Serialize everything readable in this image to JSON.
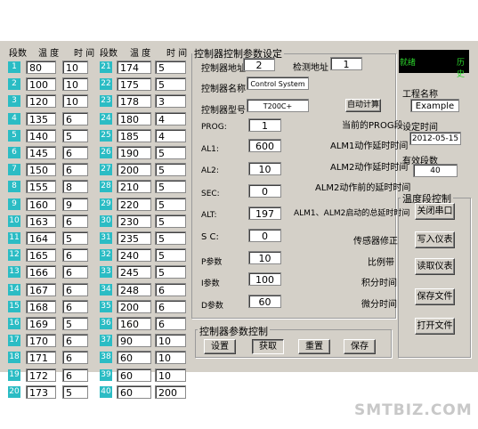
{
  "headers": {
    "left": {
      "seg": "段数",
      "temp": "温 度",
      "time": "时 间"
    },
    "right": {
      "seg": "段数",
      "temp": "温 度",
      "time": "时 间"
    }
  },
  "segments_left": [
    {
      "n": "1",
      "temp": "80",
      "time": "10"
    },
    {
      "n": "2",
      "temp": "100",
      "time": "10"
    },
    {
      "n": "3",
      "temp": "120",
      "time": "10"
    },
    {
      "n": "4",
      "temp": "135",
      "time": "6"
    },
    {
      "n": "5",
      "temp": "140",
      "time": "5"
    },
    {
      "n": "6",
      "temp": "145",
      "time": "6"
    },
    {
      "n": "7",
      "temp": "150",
      "time": "6"
    },
    {
      "n": "8",
      "temp": "155",
      "time": "8"
    },
    {
      "n": "9",
      "temp": "160",
      "time": "9"
    },
    {
      "n": "10",
      "temp": "163",
      "time": "6"
    },
    {
      "n": "11",
      "temp": "164",
      "time": "5"
    },
    {
      "n": "12",
      "temp": "165",
      "time": "6"
    },
    {
      "n": "13",
      "temp": "166",
      "time": "6"
    },
    {
      "n": "14",
      "temp": "167",
      "time": "6"
    },
    {
      "n": "15",
      "temp": "168",
      "time": "6"
    },
    {
      "n": "16",
      "temp": "169",
      "time": "5"
    },
    {
      "n": "17",
      "temp": "170",
      "time": "6"
    },
    {
      "n": "18",
      "temp": "171",
      "time": "6"
    },
    {
      "n": "19",
      "temp": "172",
      "time": "6"
    },
    {
      "n": "20",
      "temp": "173",
      "time": "5"
    }
  ],
  "segments_right": [
    {
      "n": "21",
      "temp": "174",
      "time": "5"
    },
    {
      "n": "22",
      "temp": "175",
      "time": "5"
    },
    {
      "n": "23",
      "temp": "178",
      "time": "3"
    },
    {
      "n": "24",
      "temp": "180",
      "time": "4"
    },
    {
      "n": "25",
      "temp": "185",
      "time": "4"
    },
    {
      "n": "26",
      "temp": "190",
      "time": "5"
    },
    {
      "n": "27",
      "temp": "200",
      "time": "5"
    },
    {
      "n": "28",
      "temp": "210",
      "time": "5"
    },
    {
      "n": "29",
      "temp": "220",
      "time": "5"
    },
    {
      "n": "30",
      "temp": "230",
      "time": "5"
    },
    {
      "n": "31",
      "temp": "235",
      "time": "5"
    },
    {
      "n": "32",
      "temp": "240",
      "time": "5"
    },
    {
      "n": "33",
      "temp": "245",
      "time": "5"
    },
    {
      "n": "34",
      "temp": "248",
      "time": "6"
    },
    {
      "n": "35",
      "temp": "200",
      "time": "6"
    },
    {
      "n": "36",
      "temp": "160",
      "time": "6"
    },
    {
      "n": "37",
      "temp": "90",
      "time": "10"
    },
    {
      "n": "38",
      "temp": "60",
      "time": "10"
    },
    {
      "n": "39",
      "temp": "60",
      "time": "10"
    },
    {
      "n": "40",
      "temp": "60",
      "time": "200"
    }
  ],
  "params": {
    "group_title": "控制器控制参数设定",
    "ctrl_addr_label": "控制器地址",
    "ctrl_addr": "2",
    "detect_addr_label": "检测地址",
    "detect_addr": "1",
    "ctrl_name_label": "控制器名称",
    "ctrl_name": "Control System",
    "ctrl_model_label": "控制器型号",
    "ctrl_model": "T200C+",
    "auto_calc": "自动计算",
    "prog_label": "PROG:",
    "prog": "1",
    "prog_desc": "当前的PROG段",
    "al1_label": "AL1:",
    "al1": "600",
    "al1_desc": "ALM1动作延时时间",
    "al2_label": "AL2:",
    "al2": "10",
    "al2_desc": "ALM2动作延时时间",
    "sec_label": "SEC:",
    "sec": "0",
    "sec_desc": "ALM2动作前的延时时间",
    "alt_label": "ALT:",
    "alt": "197",
    "alt_desc": "ALM1、ALM2启动的总延时时间",
    "sc_label": "S C:",
    "sc": "0",
    "sc_desc": "传感器修正",
    "p_label": "P参数",
    "p": "10",
    "p_desc": "比例带",
    "i_label": "I参数",
    "i": "100",
    "i_desc": "积分时间",
    "d_label": "D参数",
    "d": "60",
    "d_desc": "微分时间"
  },
  "param_control": {
    "title": "控制器参数控制",
    "set": "设置",
    "get": "获取",
    "reset": "重置",
    "save": "保存"
  },
  "led": {
    "left": "就绪",
    "right": "历史"
  },
  "project": {
    "name_label": "工程名称",
    "name": "Example",
    "date_label": "设定时间",
    "date": "2012-05-15",
    "segments_label": "有效段数",
    "segments": "40"
  },
  "temp_control": {
    "title": "温度段控制",
    "close_port": "关闭串口",
    "write": "写入仪表",
    "read": "读取仪表",
    "save_file": "保存文件",
    "open_file": "打开文件"
  },
  "watermark": "SMTBIZ.COM",
  "colors": {
    "window_bg": "#d4d0c8",
    "num_cell": "#2bbcc4",
    "led_text": "#2bd42b"
  }
}
